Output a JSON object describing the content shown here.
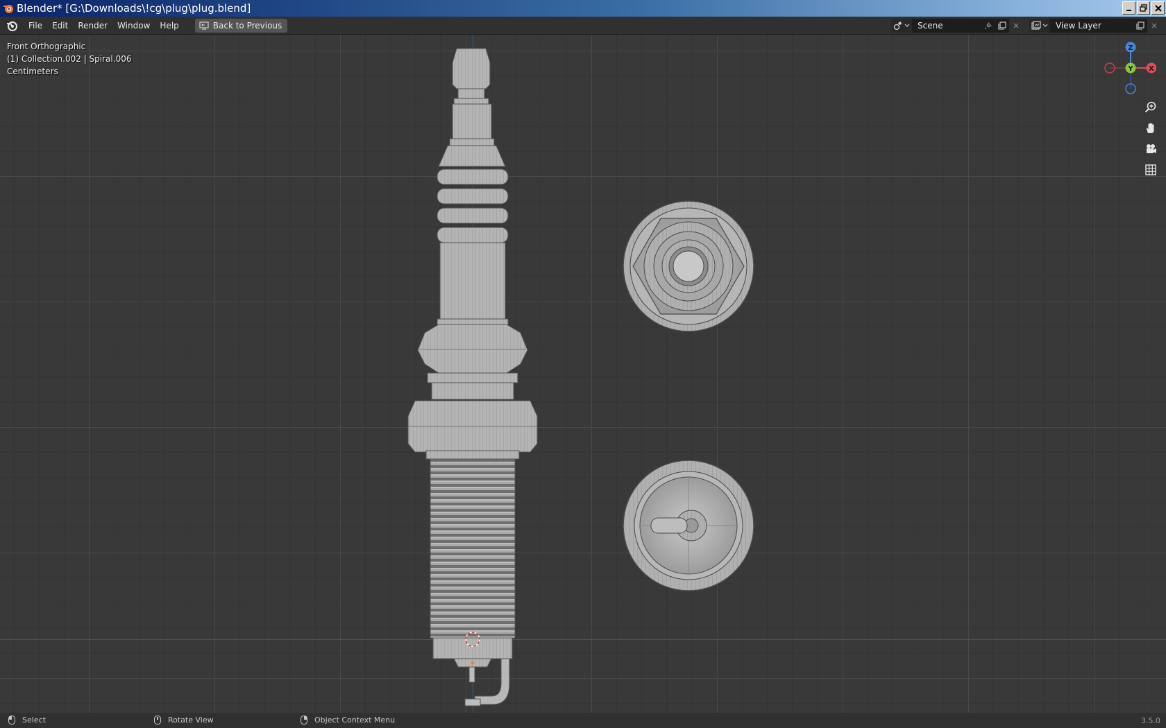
{
  "window": {
    "title": "Blender* [G:\\Downloads\\!cg\\plug\\plug.blend]"
  },
  "menu": {
    "items": [
      "File",
      "Edit",
      "Render",
      "Window",
      "Help"
    ],
    "back_button": "Back to Previous"
  },
  "scene_selector": {
    "value": "Scene",
    "icon": "scene-icon"
  },
  "view_layer_selector": {
    "value": "View Layer",
    "icon": "render-layers-icon"
  },
  "viewport": {
    "view_name": "Front Orthographic",
    "collection_info": "(1) Collection.002 | Spiral.006",
    "units": "Centimeters",
    "gizmo_axes": [
      "Z",
      "Y",
      "X"
    ],
    "nav_buttons": [
      "zoom-icon",
      "hand-pan-icon",
      "camera-icon",
      "grid-icon"
    ],
    "colors": {
      "background": "#393939",
      "x_axis": "#e04a5a",
      "y_axis": "#8ac83a",
      "z_axis": "#4a86d8",
      "mesh": "#b8b8b8"
    }
  },
  "statusbar": {
    "left": "Select",
    "middle": "Rotate View",
    "right": "Object Context Menu",
    "version": "3.5.0"
  }
}
